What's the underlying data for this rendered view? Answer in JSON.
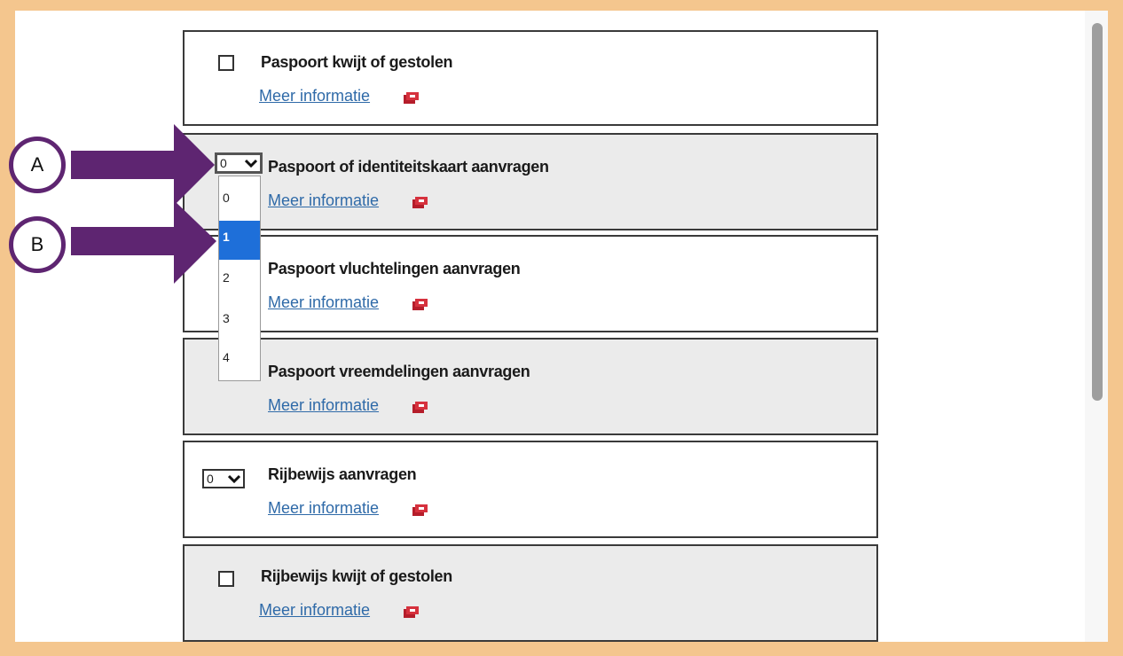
{
  "colors": {
    "accent_purple": "#5e2571",
    "link": "#2f6aa8",
    "selected_option": "#1e6fd9",
    "frame": "#f4c68e"
  },
  "items": [
    {
      "title": "Paspoort kwijt of gestolen",
      "link": "Meer informatie",
      "control": "checkbox"
    },
    {
      "title": "Paspoort of identiteitskaart aanvragen",
      "link": "Meer informatie",
      "control": "select",
      "value": "0"
    },
    {
      "title": "Paspoort vluchtelingen aanvragen",
      "link": "Meer informatie",
      "control": "select"
    },
    {
      "title": "Paspoort vreemdelingen aanvragen",
      "link": "Meer informatie",
      "control": "select"
    },
    {
      "title": "Rijbewijs aanvragen",
      "link": "Meer informatie",
      "control": "select",
      "value": "0"
    },
    {
      "title": "Rijbewijs kwijt of gestolen",
      "link": "Meer informatie",
      "control": "checkbox"
    }
  ],
  "dropdown": {
    "options": [
      "0",
      "1",
      "2",
      "3",
      "4"
    ],
    "selected": "1"
  },
  "callouts": {
    "a": "A",
    "b": "B"
  },
  "icons": {
    "external": "external-link-icon",
    "chevron": "chevron-down-icon",
    "arrow": "arrow-right-icon"
  }
}
